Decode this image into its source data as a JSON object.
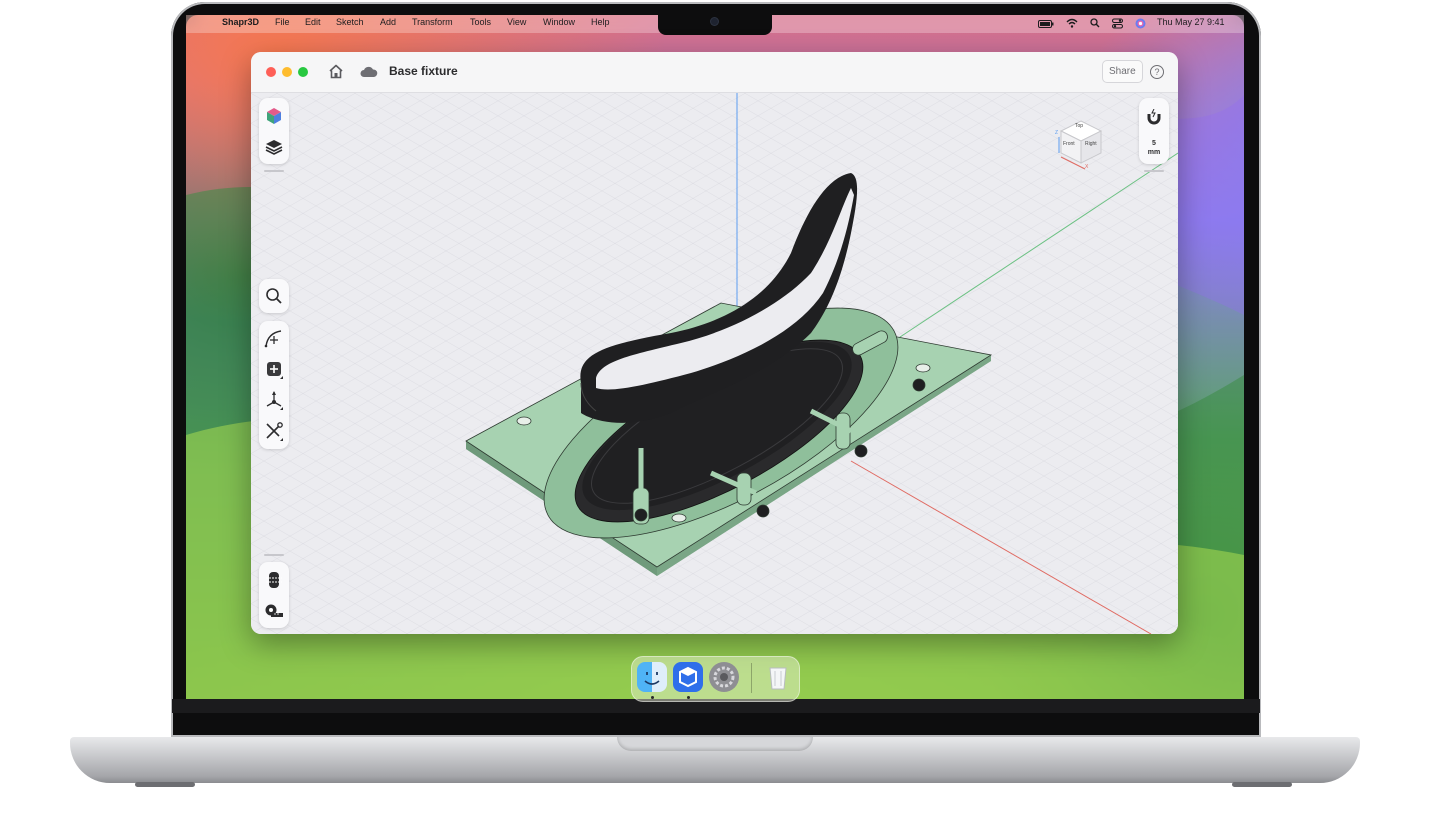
{
  "menubar": {
    "app_name": "Shapr3D",
    "items": [
      "File",
      "Edit",
      "Sketch",
      "Add",
      "Transform",
      "Tools",
      "View",
      "Window",
      "Help"
    ],
    "datetime": "Thu May 27  9:41"
  },
  "window": {
    "title": "Base fixture",
    "share_label": "Share",
    "help_label": "?"
  },
  "viewcube": {
    "top": "Top",
    "front": "Front",
    "right": "Right",
    "axis_z": "Z",
    "axis_x": "X"
  },
  "snap": {
    "value": "5",
    "unit": "mm"
  },
  "colors": {
    "part_green": "#9cc9a6",
    "part_black": "#1f1f21",
    "grid_bg": "#ececf0",
    "axis_blue": "#5b9cf0",
    "axis_green": "#6cc183",
    "axis_red": "#e06a62"
  },
  "left_tools_top": [
    "appearance-cube-icon",
    "layers-icon"
  ],
  "left_tools_mid": [
    "search-icon",
    "sketch-arc-icon",
    "add-body-icon",
    "transform-icon",
    "tools-icon"
  ],
  "left_tools_bottom": [
    "section-view-icon",
    "measure-tape-icon"
  ],
  "dock": [
    "finder",
    "shapr3d",
    "system-settings",
    "trash"
  ]
}
